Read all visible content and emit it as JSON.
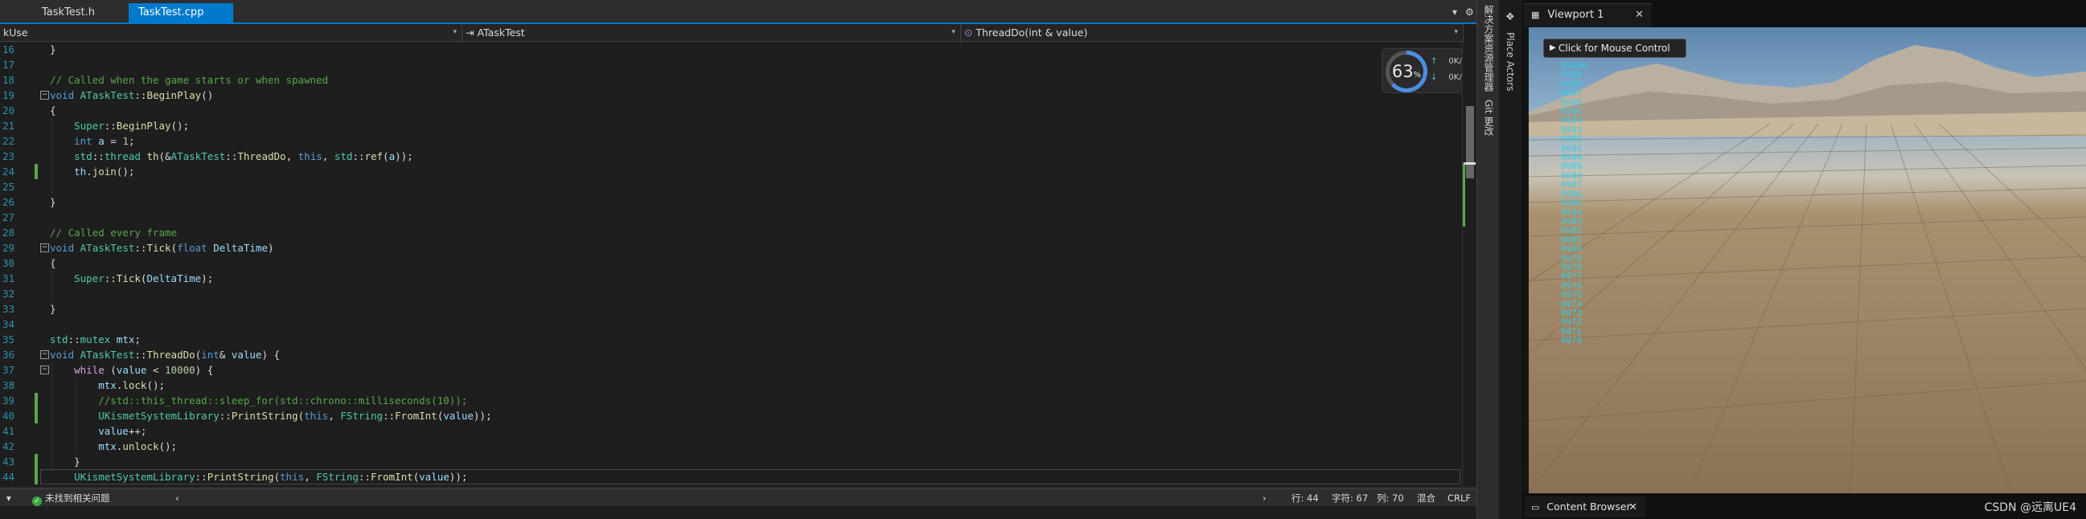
{
  "vs": {
    "tabs": [
      {
        "label": "TaskTest.h",
        "active": false
      },
      {
        "label": "TaskTest.cpp",
        "active": true,
        "pin": "⊕",
        "close": "✕"
      }
    ],
    "nav": {
      "project": "kUse",
      "class": "ATaskTest",
      "member": "ThreadDo(int & value)"
    },
    "lines": [
      {
        "n": "16",
        "tokens": [
          {
            "t": "}",
            "c": ""
          }
        ]
      },
      {
        "n": "17",
        "tokens": []
      },
      {
        "n": "18",
        "tokens": [
          {
            "t": "// Called when the game starts or when spawned",
            "c": "c-com"
          }
        ]
      },
      {
        "n": "19",
        "tokens": [
          {
            "t": "void ",
            "c": "c-kw"
          },
          {
            "t": "ATaskTest",
            "c": "c-cls"
          },
          {
            "t": "::",
            "c": ""
          },
          {
            "t": "BeginPlay",
            "c": "c-fn"
          },
          {
            "t": "()",
            "c": ""
          }
        ]
      },
      {
        "n": "20",
        "tokens": [
          {
            "t": "{",
            "c": ""
          }
        ]
      },
      {
        "n": "21",
        "tokens": [
          {
            "t": "    Super",
            "c": "c-cls"
          },
          {
            "t": "::",
            "c": ""
          },
          {
            "t": "BeginPlay",
            "c": "c-fn"
          },
          {
            "t": "();",
            "c": ""
          }
        ]
      },
      {
        "n": "22",
        "tokens": [
          {
            "t": "    int ",
            "c": "c-kw"
          },
          {
            "t": "a",
            "c": "c-var"
          },
          {
            "t": " = ",
            "c": ""
          },
          {
            "t": "1",
            "c": "c-num"
          },
          {
            "t": ";",
            "c": ""
          }
        ]
      },
      {
        "n": "23",
        "tokens": [
          {
            "t": "    std",
            "c": "c-cls"
          },
          {
            "t": "::",
            "c": ""
          },
          {
            "t": "thread ",
            "c": "c-cls"
          },
          {
            "t": "th",
            "c": "c-fn"
          },
          {
            "t": "(&",
            "c": ""
          },
          {
            "t": "ATaskTest",
            "c": "c-cls"
          },
          {
            "t": "::",
            "c": ""
          },
          {
            "t": "ThreadDo",
            "c": "c-fn"
          },
          {
            "t": ", ",
            "c": ""
          },
          {
            "t": "this",
            "c": "c-kw"
          },
          {
            "t": ", ",
            "c": ""
          },
          {
            "t": "std",
            "c": "c-cls"
          },
          {
            "t": "::",
            "c": ""
          },
          {
            "t": "ref",
            "c": "c-fn"
          },
          {
            "t": "(",
            "c": ""
          },
          {
            "t": "a",
            "c": "c-var"
          },
          {
            "t": "));",
            "c": ""
          }
        ]
      },
      {
        "n": "24",
        "tokens": [
          {
            "t": "    th",
            "c": "c-var"
          },
          {
            "t": ".",
            "c": ""
          },
          {
            "t": "join",
            "c": "c-fn"
          },
          {
            "t": "();",
            "c": ""
          }
        ]
      },
      {
        "n": "25",
        "tokens": []
      },
      {
        "n": "26",
        "tokens": [
          {
            "t": "}",
            "c": ""
          }
        ]
      },
      {
        "n": "27",
        "tokens": []
      },
      {
        "n": "28",
        "tokens": [
          {
            "t": "// Called every frame",
            "c": "c-com"
          }
        ]
      },
      {
        "n": "29",
        "tokens": [
          {
            "t": "void ",
            "c": "c-kw"
          },
          {
            "t": "ATaskTest",
            "c": "c-cls"
          },
          {
            "t": "::",
            "c": ""
          },
          {
            "t": "Tick",
            "c": "c-fn"
          },
          {
            "t": "(",
            "c": ""
          },
          {
            "t": "float ",
            "c": "c-kw"
          },
          {
            "t": "DeltaTime",
            "c": "c-var"
          },
          {
            "t": ")",
            "c": ""
          }
        ]
      },
      {
        "n": "30",
        "tokens": [
          {
            "t": "{",
            "c": ""
          }
        ]
      },
      {
        "n": "31",
        "tokens": [
          {
            "t": "    Super",
            "c": "c-cls"
          },
          {
            "t": "::",
            "c": ""
          },
          {
            "t": "Tick",
            "c": "c-fn"
          },
          {
            "t": "(",
            "c": ""
          },
          {
            "t": "DeltaTime",
            "c": "c-var"
          },
          {
            "t": ");",
            "c": ""
          }
        ]
      },
      {
        "n": "32",
        "tokens": []
      },
      {
        "n": "33",
        "tokens": [
          {
            "t": "}",
            "c": ""
          }
        ]
      },
      {
        "n": "34",
        "tokens": []
      },
      {
        "n": "35",
        "tokens": [
          {
            "t": "std",
            "c": "c-cls"
          },
          {
            "t": "::",
            "c": ""
          },
          {
            "t": "mutex ",
            "c": "c-cls"
          },
          {
            "t": "mtx",
            "c": "c-var"
          },
          {
            "t": ";",
            "c": ""
          }
        ]
      },
      {
        "n": "36",
        "tokens": [
          {
            "t": "void ",
            "c": "c-kw"
          },
          {
            "t": "ATaskTest",
            "c": "c-cls"
          },
          {
            "t": "::",
            "c": ""
          },
          {
            "t": "ThreadDo",
            "c": "c-fn"
          },
          {
            "t": "(",
            "c": ""
          },
          {
            "t": "int",
            "c": "c-kw"
          },
          {
            "t": "& ",
            "c": ""
          },
          {
            "t": "value",
            "c": "c-var"
          },
          {
            "t": ") {",
            "c": ""
          }
        ]
      },
      {
        "n": "37",
        "tokens": [
          {
            "t": "    while ",
            "c": "c-ctrl"
          },
          {
            "t": "(",
            "c": ""
          },
          {
            "t": "value",
            "c": "c-var"
          },
          {
            "t": " < ",
            "c": ""
          },
          {
            "t": "10000",
            "c": "c-num"
          },
          {
            "t": ") {",
            "c": ""
          }
        ]
      },
      {
        "n": "38",
        "tokens": [
          {
            "t": "        mtx",
            "c": "c-var"
          },
          {
            "t": ".",
            "c": ""
          },
          {
            "t": "lock",
            "c": "c-fn"
          },
          {
            "t": "();",
            "c": ""
          }
        ]
      },
      {
        "n": "39",
        "tokens": [
          {
            "t": "        //std::this_thread::sleep_for(std::chrono::milliseconds(10));",
            "c": "c-com"
          }
        ]
      },
      {
        "n": "40",
        "tokens": [
          {
            "t": "        UKismetSystemLibrary",
            "c": "c-cls"
          },
          {
            "t": "::",
            "c": ""
          },
          {
            "t": "PrintString",
            "c": "c-fn"
          },
          {
            "t": "(",
            "c": ""
          },
          {
            "t": "this",
            "c": "c-kw"
          },
          {
            "t": ", ",
            "c": ""
          },
          {
            "t": "FString",
            "c": "c-cls"
          },
          {
            "t": "::",
            "c": ""
          },
          {
            "t": "FromInt",
            "c": "c-fn"
          },
          {
            "t": "(",
            "c": ""
          },
          {
            "t": "value",
            "c": "c-var"
          },
          {
            "t": "));",
            "c": ""
          }
        ]
      },
      {
        "n": "41",
        "tokens": [
          {
            "t": "        value",
            "c": "c-var"
          },
          {
            "t": "++;",
            "c": ""
          }
        ]
      },
      {
        "n": "42",
        "tokens": [
          {
            "t": "        mtx",
            "c": "c-var"
          },
          {
            "t": ".",
            "c": ""
          },
          {
            "t": "unlock",
            "c": "c-fn"
          },
          {
            "t": "();",
            "c": ""
          }
        ]
      },
      {
        "n": "43",
        "tokens": [
          {
            "t": "    }",
            "c": ""
          }
        ]
      },
      {
        "n": "44",
        "tokens": [
          {
            "t": "    UKismetSystemLibrary",
            "c": "c-cls"
          },
          {
            "t": "::",
            "c": ""
          },
          {
            "t": "PrintString",
            "c": "c-fn"
          },
          {
            "t": "(",
            "c": ""
          },
          {
            "t": "this",
            "c": "c-kw"
          },
          {
            "t": ", ",
            "c": ""
          },
          {
            "t": "FString",
            "c": "c-cls"
          },
          {
            "t": "::",
            "c": ""
          },
          {
            "t": "FromInt",
            "c": "c-fn"
          },
          {
            "t": "(",
            "c": ""
          },
          {
            "t": "value",
            "c": "c-var"
          },
          {
            "t": "));",
            "c": ""
          }
        ]
      }
    ],
    "perf": {
      "value": "63",
      "unit": "%",
      "up": "0",
      "down": "0",
      "rate_unit": "K/s"
    },
    "status": {
      "problems": "未找到相关问题",
      "line": "行: 44",
      "char": "字符: 67",
      "col": "列: 70",
      "mode": "混合",
      "eol": "CRLF"
    },
    "side_labels": [
      "解决方案资源管理器",
      "Git 更改"
    ]
  },
  "ue": {
    "side_label": "Place Actors",
    "viewport_tab": "Viewport 1",
    "viewport_close": "✕",
    "mouse_control": "Click for Mouse Control",
    "log": [
      "10000",
      "9999",
      "9998",
      "9997",
      "9996",
      "9995",
      "9994",
      "9993",
      "9992",
      "9991",
      "9990",
      "9989",
      "9988",
      "9987",
      "9986",
      "9985",
      "9984",
      "9983",
      "9982",
      "9981",
      "9980",
      "9979",
      "9978",
      "9977",
      "9976",
      "9975",
      "9974",
      "9973",
      "9972",
      "9971",
      "9970"
    ],
    "content_browser": "Content Browser",
    "content_close": "✕",
    "watermark": "CSDN @远离UE4"
  }
}
